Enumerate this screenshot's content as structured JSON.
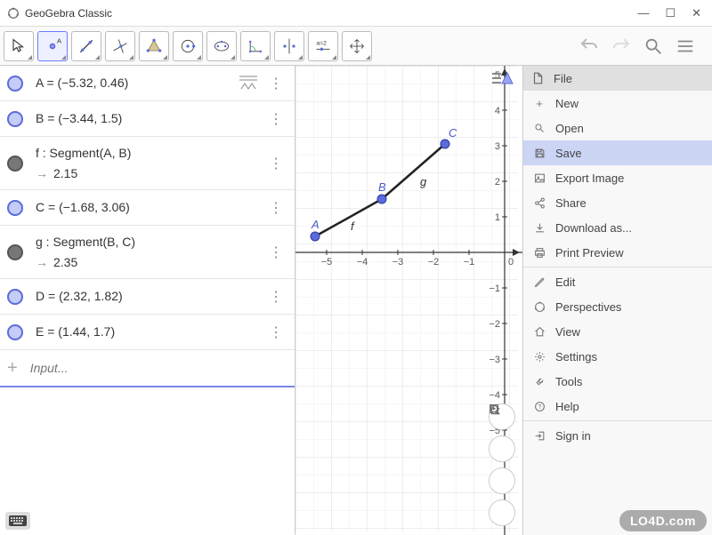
{
  "window": {
    "title": "GeoGebra Classic"
  },
  "algebra": {
    "rows": [
      {
        "bullet": "light",
        "text": "A = (−5.32, 0.46)"
      },
      {
        "bullet": "light",
        "text": "B = (−3.44, 1.5)"
      },
      {
        "bullet": "dark",
        "text1": "f : Segment(A, B)",
        "text2": "2.15"
      },
      {
        "bullet": "light",
        "text": "C = (−1.68, 3.06)"
      },
      {
        "bullet": "dark",
        "text1": "g : Segment(B, C)",
        "text2": "2.35"
      },
      {
        "bullet": "light",
        "text": "D = (2.32, 1.82)"
      },
      {
        "bullet": "light",
        "text": "E = (1.44, 1.7)"
      }
    ],
    "input_placeholder": "Input..."
  },
  "chart_data": {
    "type": "line",
    "title": "",
    "xlabel": "",
    "ylabel": "",
    "xlim": [
      -5.5,
      0.5
    ],
    "ylim": [
      -5.2,
      5.2
    ],
    "x_ticks": [
      -5,
      -4,
      -3,
      -2,
      -1,
      0
    ],
    "y_ticks": [
      -5,
      -4,
      -3,
      -2,
      -1,
      1,
      2,
      3,
      4,
      5
    ],
    "points": [
      {
        "name": "A",
        "x": -5.32,
        "y": 0.46
      },
      {
        "name": "B",
        "x": -3.44,
        "y": 1.5
      },
      {
        "name": "C",
        "x": -1.68,
        "y": 3.06
      },
      {
        "name": "D",
        "x": 2.32,
        "y": 1.82
      },
      {
        "name": "E",
        "x": 1.44,
        "y": 1.7
      }
    ],
    "segments": [
      {
        "name": "f",
        "from": "A",
        "to": "B",
        "length": 2.15
      },
      {
        "name": "g",
        "from": "B",
        "to": "C",
        "length": 2.35
      }
    ]
  },
  "menu": {
    "file_header": "File",
    "items_file": [
      "New",
      "Open",
      "Save",
      "Export Image",
      "Share",
      "Download as...",
      "Print Preview"
    ],
    "items_main": [
      "Edit",
      "Perspectives",
      "View",
      "Settings",
      "Tools",
      "Help",
      "Sign in"
    ]
  },
  "watermark": "LO4D.com"
}
